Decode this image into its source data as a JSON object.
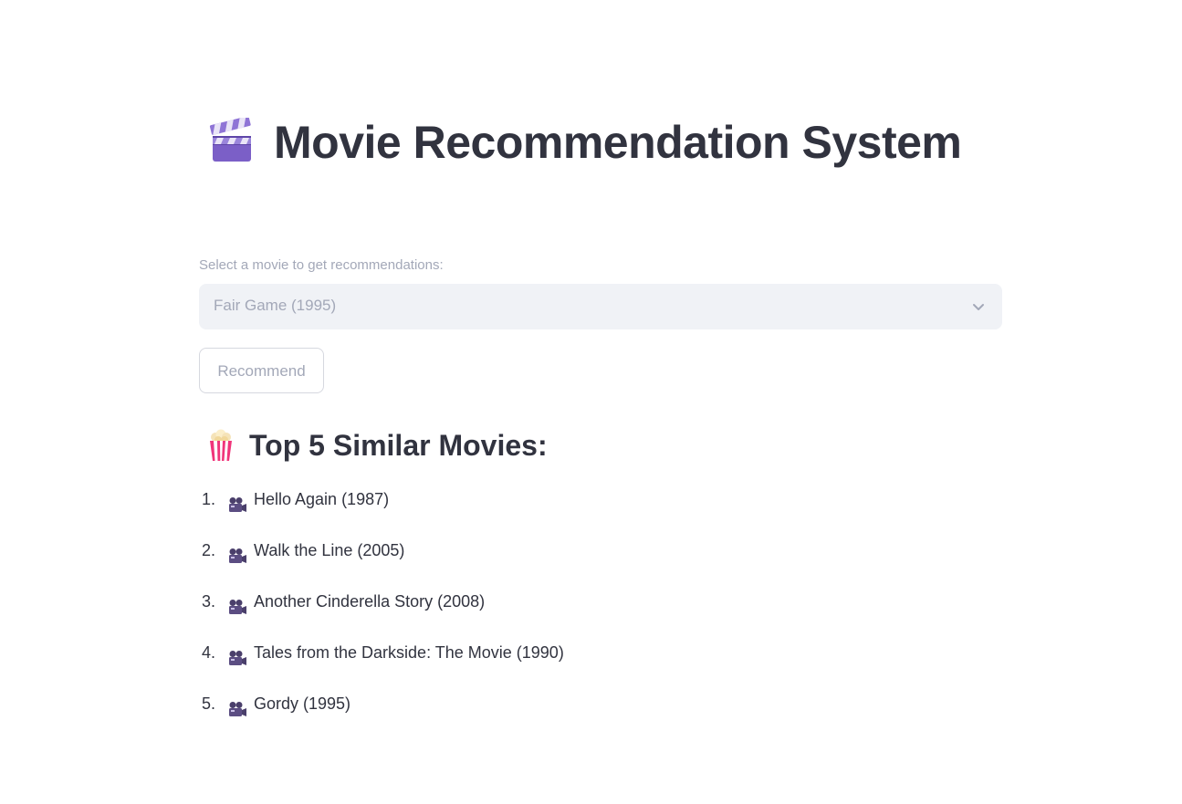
{
  "page": {
    "title": "Movie Recommendation System",
    "title_icon": "clapper-board-icon"
  },
  "selector": {
    "label": "Select a movie to get recommendations:",
    "selected_value": "Fair Game (1995)",
    "icon": "chevron-down-icon"
  },
  "actions": {
    "recommend_label": "Recommend"
  },
  "results": {
    "heading": "Top 5 Similar Movies:",
    "heading_icon": "popcorn-icon",
    "item_icon": "movie-camera-icon",
    "items": [
      {
        "number": "1.",
        "title": "Hello Again (1987)"
      },
      {
        "number": "2.",
        "title": "Walk the Line (2005)"
      },
      {
        "number": "3.",
        "title": "Another Cinderella Story (2008)"
      },
      {
        "number": "4.",
        "title": "Tales from the Darkside: The Movie (1990)"
      },
      {
        "number": "5.",
        "title": "Gordy (1995)"
      }
    ]
  },
  "colors": {
    "text": "#31333f",
    "muted": "#a3a8b8",
    "select_bg": "#f0f2f6",
    "border": "#d6d8df",
    "clapper_purple": "#7b5fc7",
    "popcorn_pink": "#f0357a"
  }
}
